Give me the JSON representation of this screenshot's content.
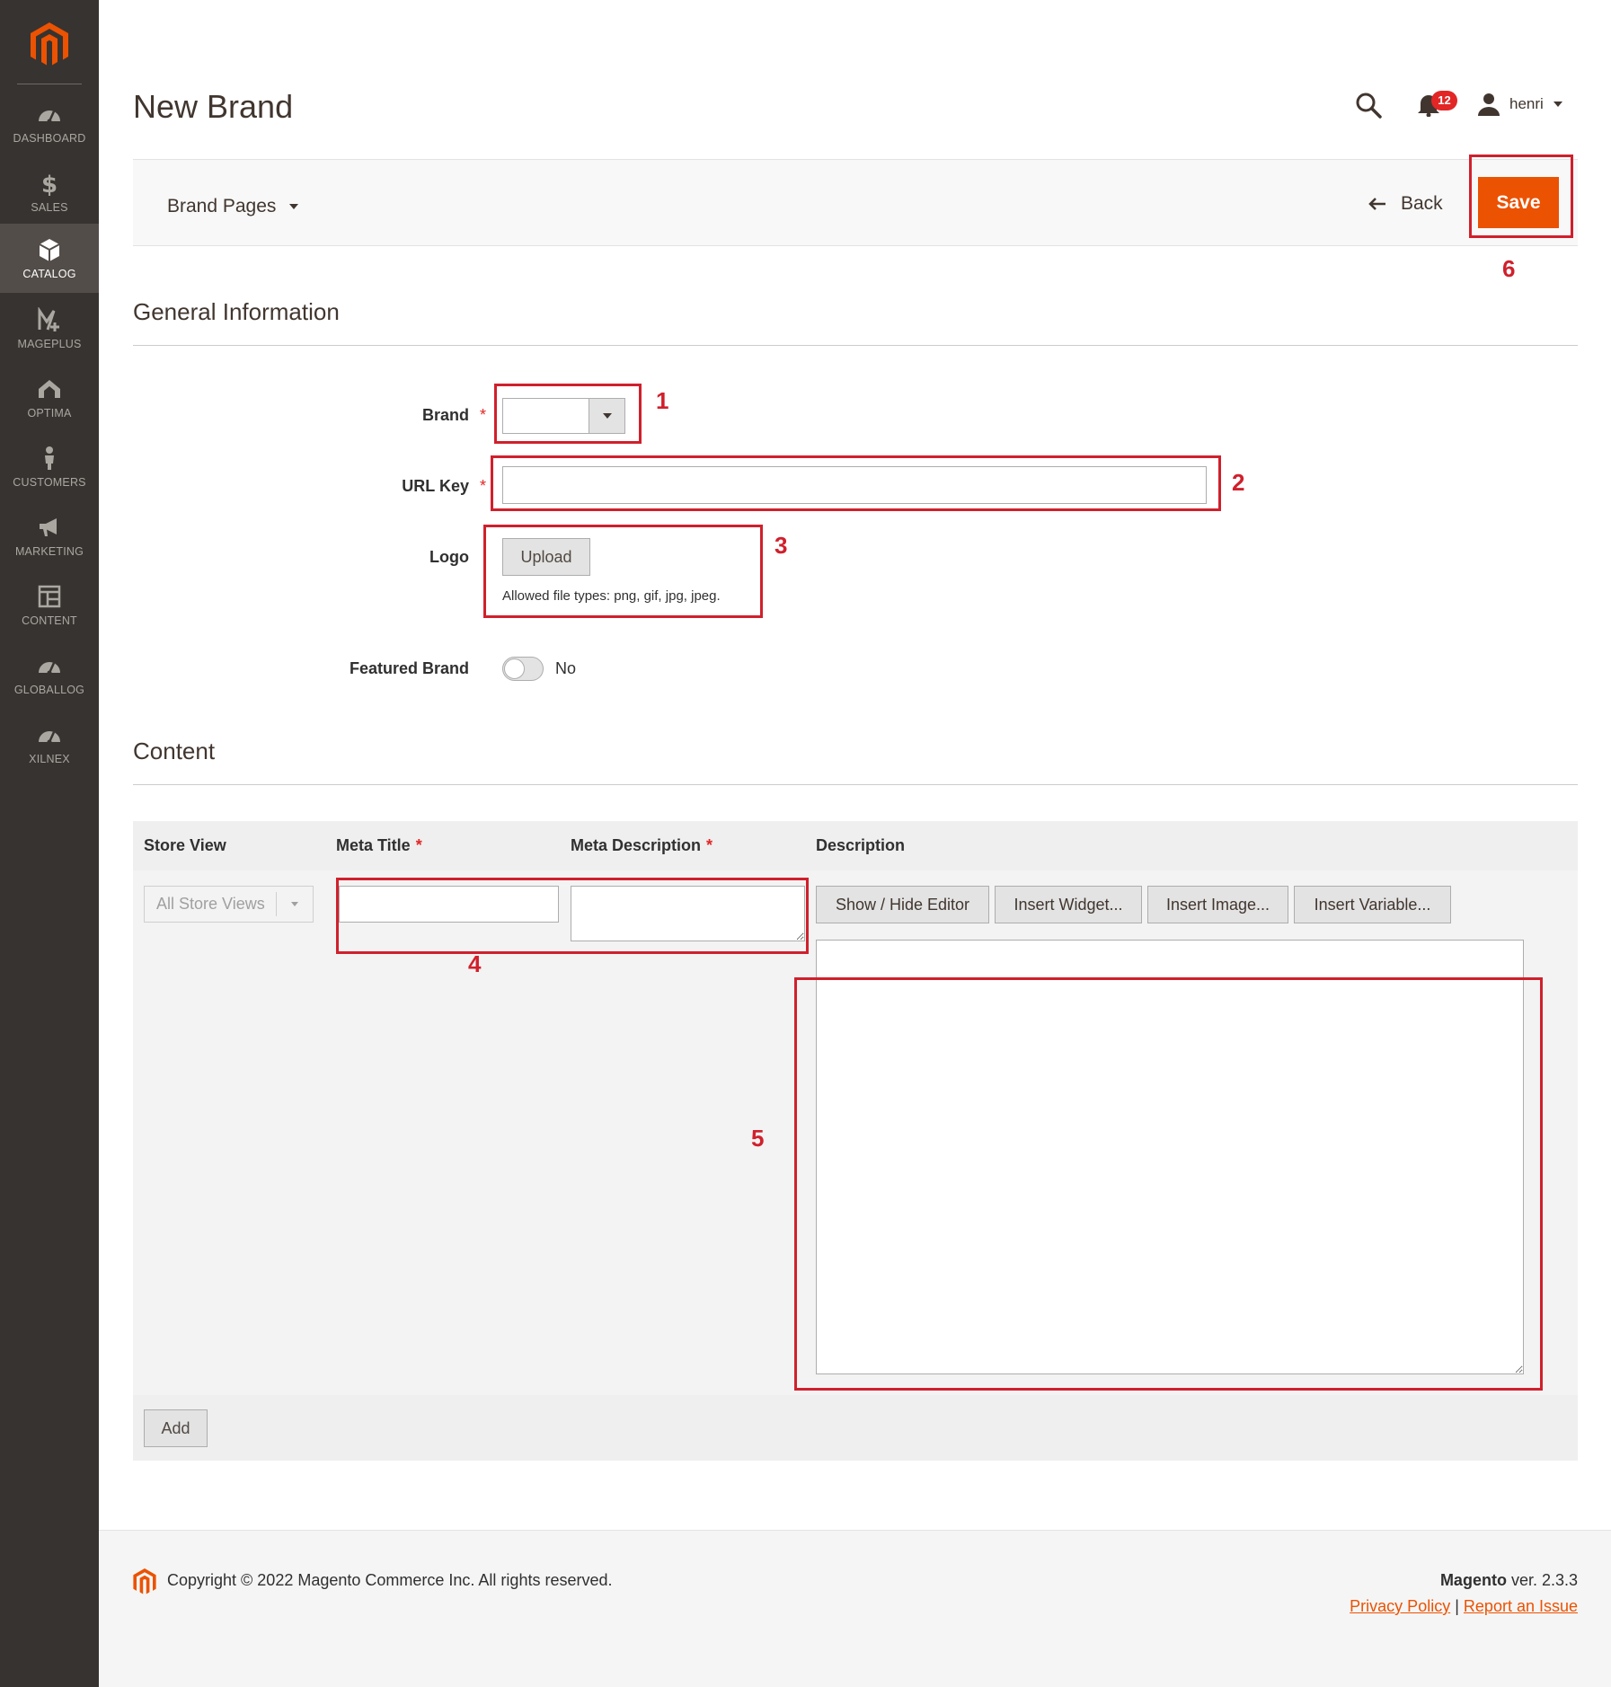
{
  "sidebar": {
    "items": [
      {
        "label": "DASHBOARD",
        "icon": "dashboard-icon"
      },
      {
        "label": "SALES",
        "icon": "dollar-icon"
      },
      {
        "label": "CATALOG",
        "icon": "box-icon",
        "active": true
      },
      {
        "label": "MAGEPLUS",
        "icon": "mageplus-icon"
      },
      {
        "label": "OPTIMA",
        "icon": "optima-icon"
      },
      {
        "label": "CUSTOMERS",
        "icon": "person-icon"
      },
      {
        "label": "MARKETING",
        "icon": "megaphone-icon"
      },
      {
        "label": "CONTENT",
        "icon": "layout-icon"
      },
      {
        "label": "GLOBALLOG",
        "icon": "gauge-icon"
      },
      {
        "label": "XILNEX",
        "icon": "gauge-icon"
      }
    ]
  },
  "header": {
    "title": "New Brand",
    "notifications_count": "12",
    "user_name": "henri"
  },
  "actions": {
    "store_switcher": "Brand Pages",
    "back_label": "Back",
    "save_label": "Save"
  },
  "general": {
    "title": "General Information",
    "brand_label": "Brand",
    "brand_value": "",
    "url_key_label": "URL Key",
    "url_key_value": "",
    "logo_label": "Logo",
    "upload_label": "Upload",
    "allowed_types": "Allowed file types: png, gif, jpg, jpeg.",
    "featured_label": "Featured Brand",
    "featured_value": "No",
    "required_mark": "*"
  },
  "content": {
    "title": "Content",
    "columns": [
      "Store View",
      "Meta Title",
      "Meta Description",
      "Description"
    ],
    "store_view_value": "All Store Views",
    "editor_buttons": [
      "Show / Hide Editor",
      "Insert Widget...",
      "Insert Image...",
      "Insert Variable..."
    ],
    "add_label": "Add"
  },
  "annotations": [
    "1",
    "2",
    "3",
    "4",
    "5",
    "6"
  ],
  "footer": {
    "copyright": "Copyright © 2022 Magento Commerce Inc. All rights reserved.",
    "brand": "Magento",
    "version": " ver. 2.3.3",
    "privacy": "Privacy Policy",
    "separator": "|",
    "report": "Report an Issue"
  },
  "colors": {
    "accent": "#eb5202",
    "sidebar_bg": "#373330",
    "annotation": "#d0202c"
  }
}
